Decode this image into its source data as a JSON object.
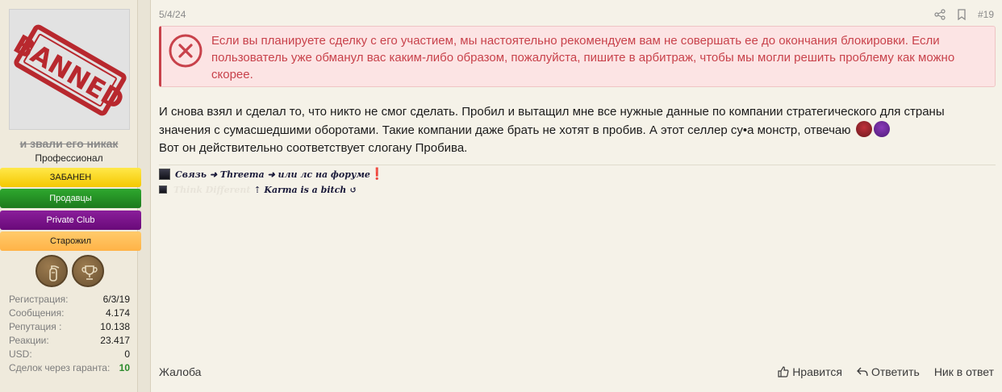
{
  "user": {
    "avatar_stamp_text": "BANNED",
    "username": "и звали его никак",
    "title": "Профессионал",
    "banners": [
      "ЗАБАНЕН",
      "Продавцы",
      "Private Club",
      "Старожил"
    ],
    "trophies": [
      "fire-extinguisher-icon",
      "cup-icon"
    ],
    "stats": [
      {
        "label": "Регистрация:",
        "value": "6/3/19"
      },
      {
        "label": "Сообщения:",
        "value": "4.174"
      },
      {
        "label": "Репутация :",
        "value": "10.138"
      },
      {
        "label": "Реакции:",
        "value": "23.417"
      },
      {
        "label": "USD:",
        "value": "0"
      },
      {
        "label": "Сделок через гаранта:",
        "value": "10"
      }
    ]
  },
  "post": {
    "date": "5/4/24",
    "number": "#19",
    "alert": "Если вы планируете сделку с его участием, мы настоятельно рекомендуем вам не совершать ее до окончания блокировки. Если пользователь уже обманул вас каким-либо образом, пожалуйста, пишите в арбитраж, чтобы мы могли решить проблему как можно скорее.",
    "body_line1": "И снова взял и сделал то, что никто не смог сделать. Пробил и вытащил мне все нужные данные по компании стратегического для страны значения с сумасшедшими оборотами. Такие компании даже брать не хотят в пробив. А этот селлер су•а монстр, отвечаю",
    "body_line2": "Вот он действительно соответствует слогану Пробива.",
    "signature": {
      "line1_text": "Связь ➜ Threema ➜ или лс на форуме",
      "line1_mark": "❗",
      "line2_hidden": "Think Different",
      "line2_text": "⇡ Karma is a bitch ↺"
    },
    "footer": {
      "report": "Жалоба",
      "like": "Нравится",
      "reply": "Ответить",
      "nick": "Ник в ответ"
    }
  },
  "colors": {
    "alert_text": "#c8424b",
    "banned_banner": "#f5c800",
    "sellers_banner": "#1d7a1d",
    "private_club_banner": "#6a0a7a",
    "oldtimer_banner": "#ffb347"
  }
}
